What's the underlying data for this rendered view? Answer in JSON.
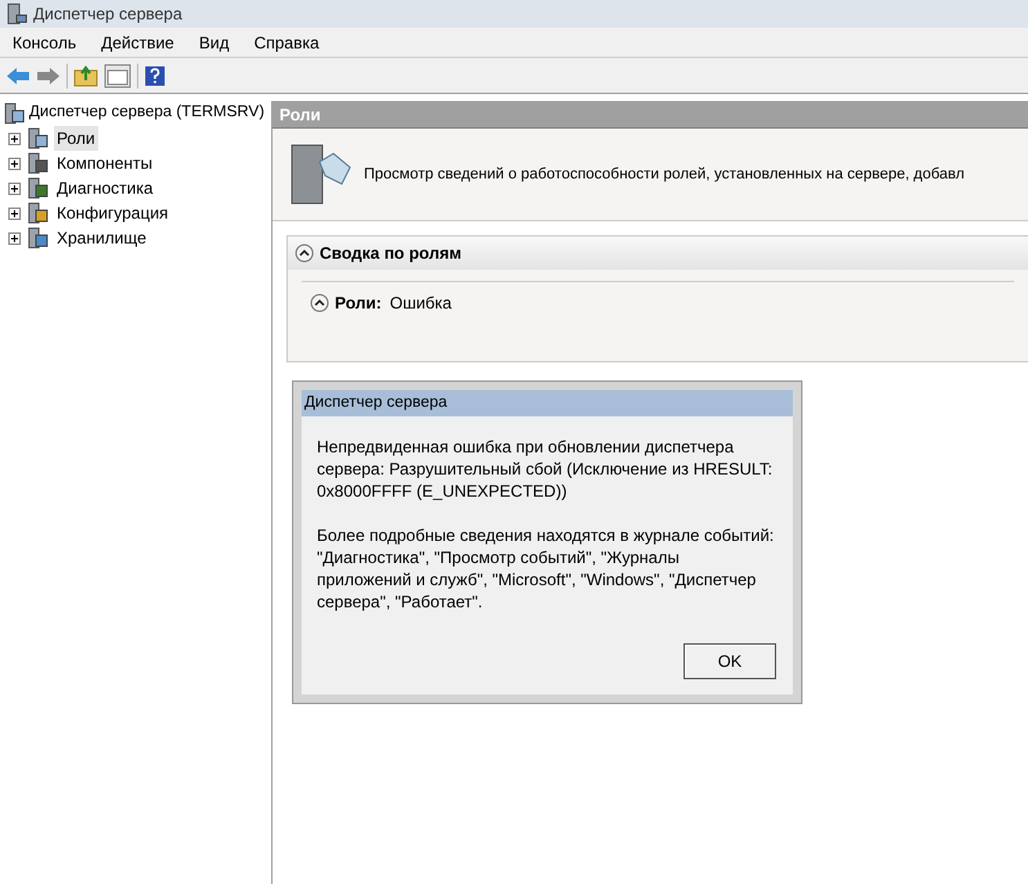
{
  "window": {
    "title": "Диспетчер сервера"
  },
  "menu": [
    "Консоль",
    "Действие",
    "Вид",
    "Справка"
  ],
  "tree": {
    "root": "Диспетчер сервера (TERMSRV)",
    "items": [
      {
        "label": "Роли",
        "kind": "roles",
        "selected": true,
        "expanded": false
      },
      {
        "label": "Компоненты",
        "kind": "features",
        "selected": false,
        "expanded": false
      },
      {
        "label": "Диагностика",
        "kind": "diagnostics",
        "selected": false,
        "expanded": false
      },
      {
        "label": "Конфигурация",
        "kind": "configuration",
        "selected": false,
        "expanded": false
      },
      {
        "label": "Хранилище",
        "kind": "storage",
        "selected": false,
        "expanded": false
      }
    ]
  },
  "content": {
    "header": "Роли",
    "description": "Просмотр сведений о работоспособности ролей, установленных на сервере, добавл",
    "section": {
      "title": "Сводка по ролям",
      "expanded": true,
      "row": {
        "label": "Роли:",
        "value": "Ошибка",
        "expanded": true
      }
    }
  },
  "dialog": {
    "title": "Диспетчер сервера",
    "message": "Непредвиденная ошибка при обновлении диспетчера сервера: Разрушительный сбой (Исключение из HRESULT: 0x8000FFFF (E_UNEXPECTED))",
    "details": "Более подробные сведения находятся в журнале событий: \"Диагностика\", \"Просмотр событий\", \"Журналы приложений и служб\", \"Microsoft\", \"Windows\", \"Диспетчер сервера\", \"Работает\".",
    "button": "OK"
  }
}
